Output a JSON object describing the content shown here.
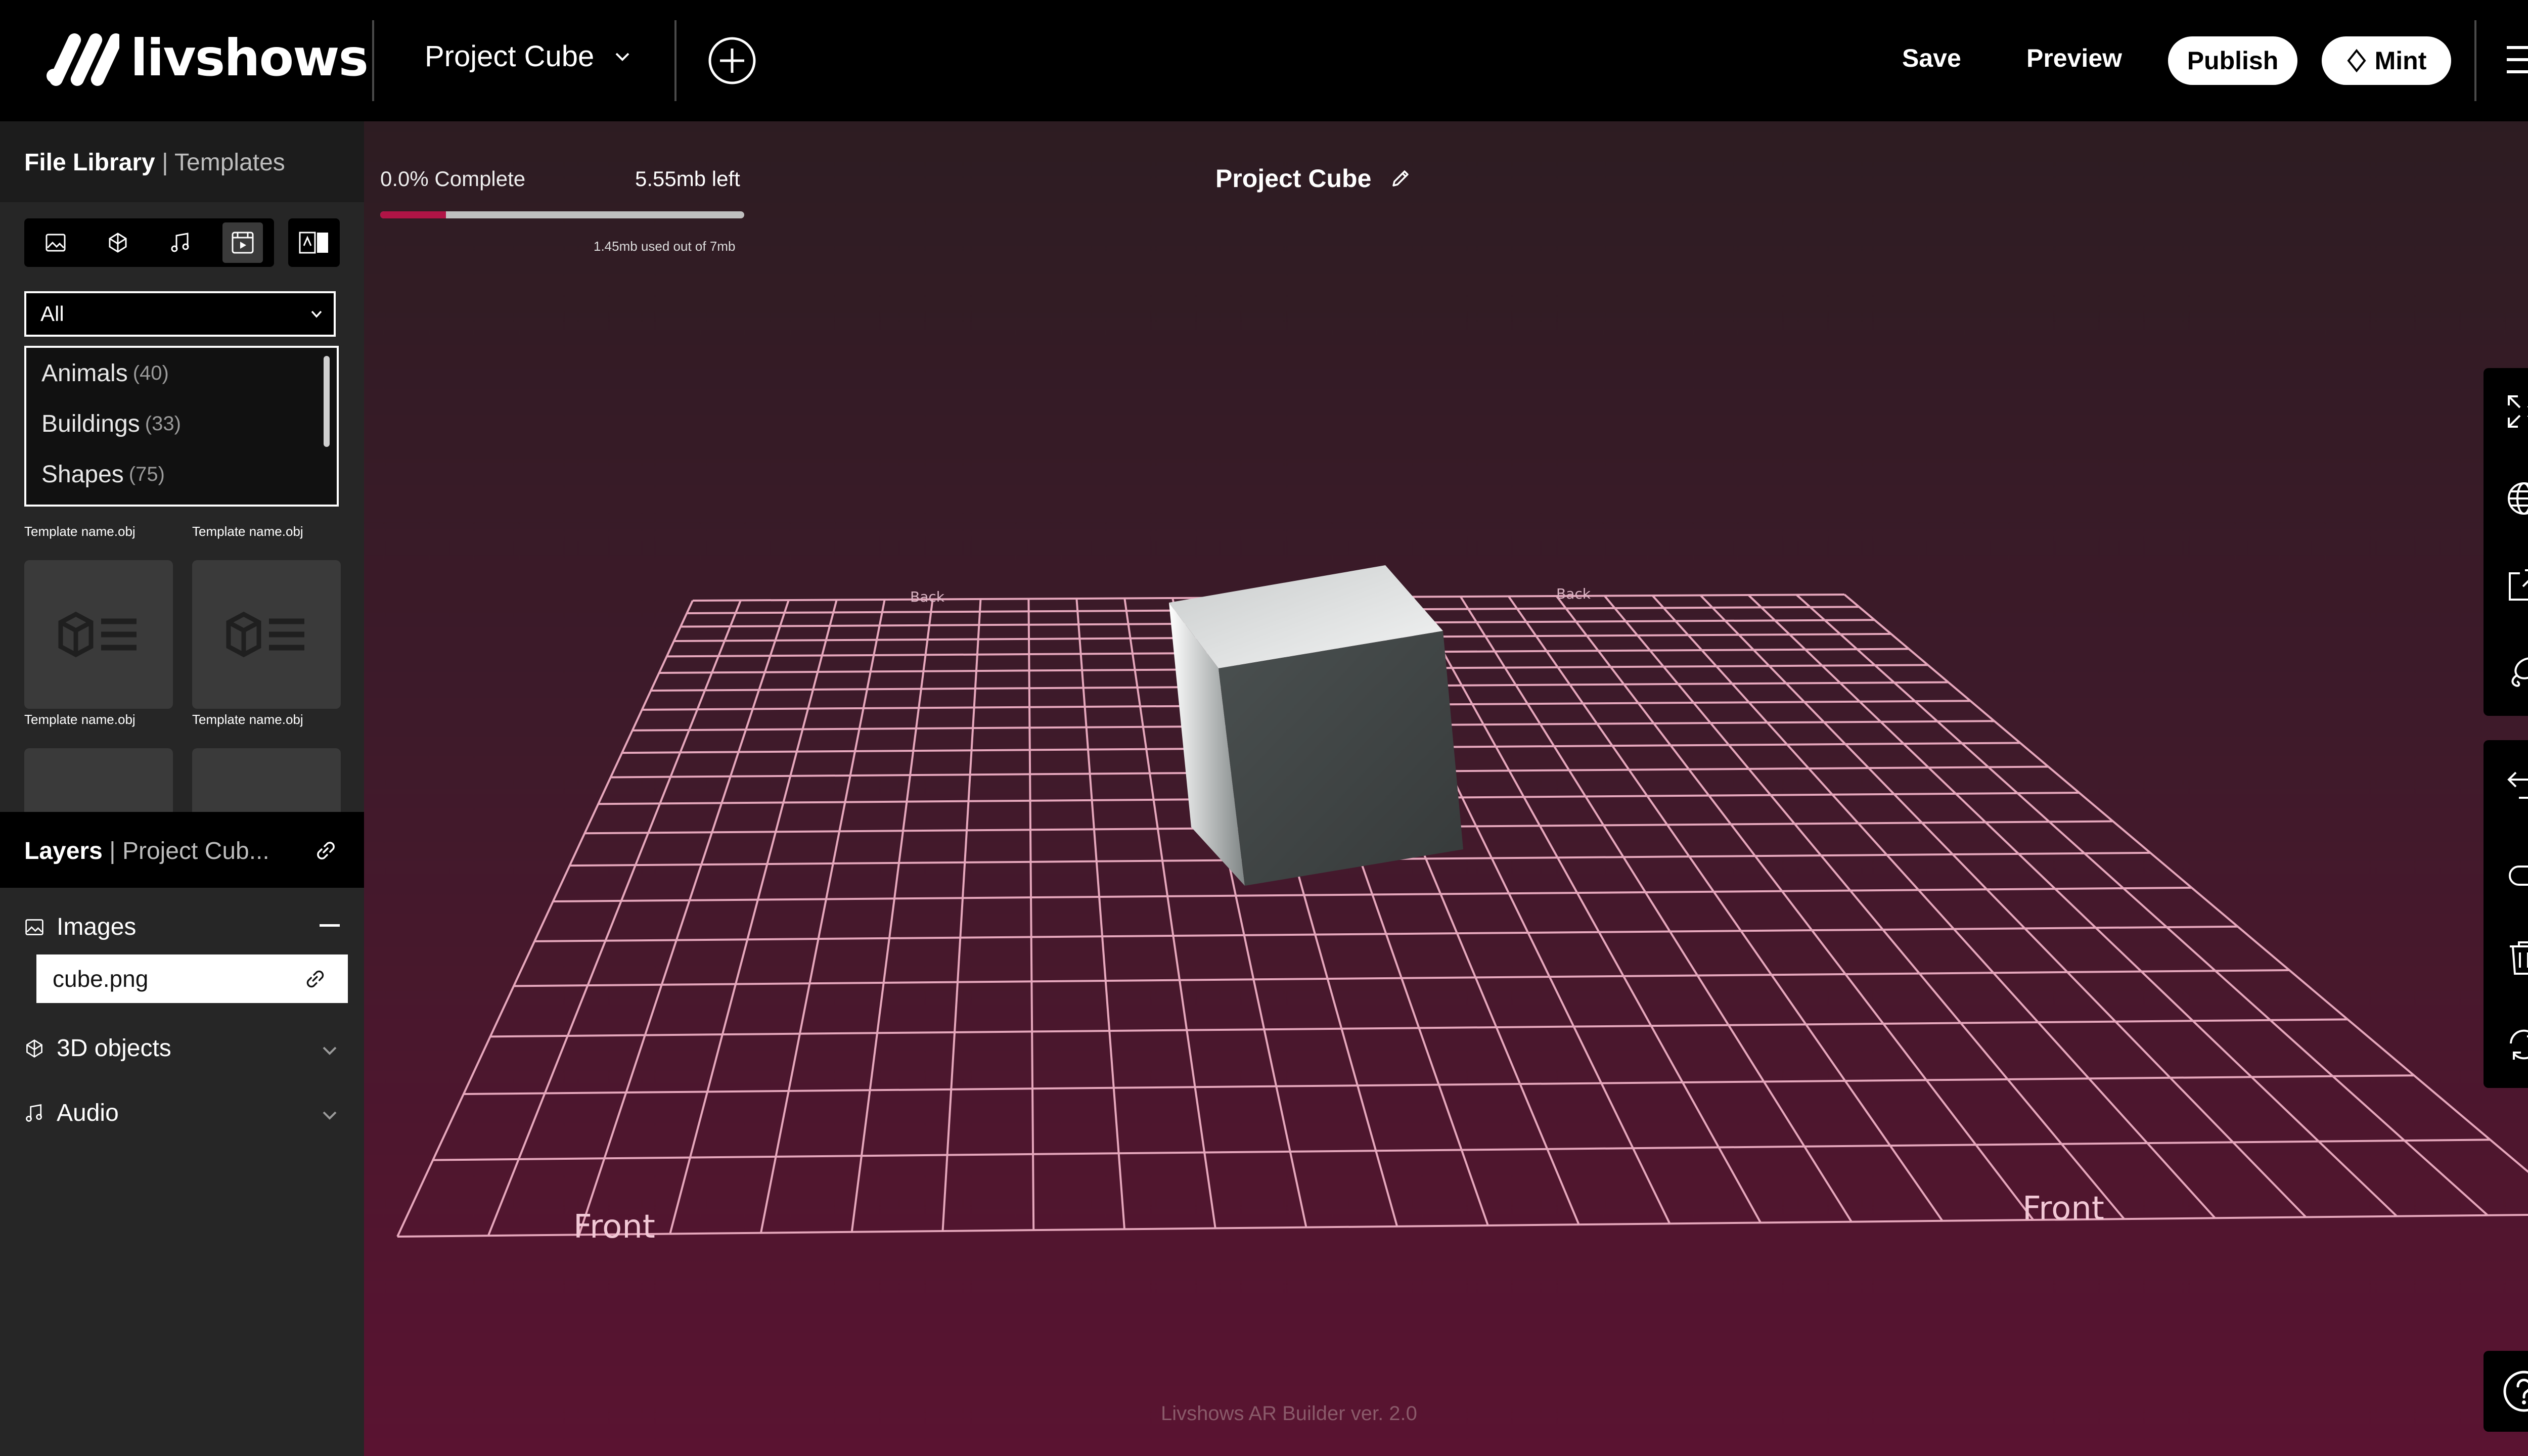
{
  "app": {
    "logo_text": "livshows"
  },
  "header": {
    "project_name": "Project Cube",
    "save_label": "Save",
    "preview_label": "Preview",
    "publish_label": "Publish",
    "mint_label": "Mint"
  },
  "file_library": {
    "title": "File Library",
    "tab_separator": "|",
    "templates_tab": "Templates",
    "filter_types": [
      "image-icon",
      "3d-object-icon",
      "music-note-icon",
      "video-icon",
      "ar-icon"
    ],
    "category_selected": "All",
    "category_options": [
      {
        "name": "Animals",
        "count": "(40)"
      },
      {
        "name": "Buildings",
        "count": "(33)"
      },
      {
        "name": "Shapes",
        "count": "(75)"
      }
    ],
    "tiles": [
      {
        "label": "Template name.obj"
      },
      {
        "label": "Template name.obj"
      },
      {
        "label": "Template name.obj"
      },
      {
        "label": "Template name.obj"
      }
    ]
  },
  "layers": {
    "title": "Layers",
    "separator": "|",
    "project": "Project Cub...",
    "groups": {
      "images": "Images",
      "objects_3d": "3D objects",
      "audio": "Audio"
    },
    "items": [
      {
        "name": "cube.png"
      }
    ]
  },
  "canvas": {
    "progress_label": "0.0% Complete",
    "progress_fraction": 0.18,
    "mb_left": "5.55mb left",
    "usage_note": "1.45mb used out of 7mb",
    "title": "Project Cube",
    "grid_front_label": "Front",
    "grid_back_label": "Back",
    "version": "Livshows AR Builder ver. 2.0"
  },
  "colors": {
    "accent": "#b01446",
    "grid": "#e6a7bc",
    "canvas_top": "#2d1c22",
    "canvas_bottom": "#5a1331"
  }
}
